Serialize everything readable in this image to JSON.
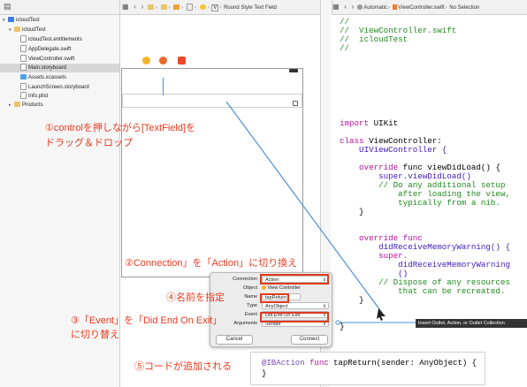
{
  "navigator": {
    "items": [
      {
        "label": "icloudTest",
        "icon": "project-icon",
        "arrow": "▾"
      },
      {
        "label": "icloudTest",
        "icon": "folder-icon",
        "arrow": "▾"
      },
      {
        "label": "icloudTest.entitlements",
        "icon": "file-icon"
      },
      {
        "label": "AppDelegate.swift",
        "icon": "swift-file-icon"
      },
      {
        "label": "ViewController.swift",
        "icon": "swift-file-icon"
      },
      {
        "label": "Main.storyboard",
        "icon": "storyboard-icon",
        "selected": true
      },
      {
        "label": "Assets.xcassets",
        "icon": "asset-catalog-icon"
      },
      {
        "label": "LaunchScreen.storyboard",
        "icon": "storyboard-icon"
      },
      {
        "label": "Info.plist",
        "icon": "plist-icon"
      },
      {
        "label": "Products",
        "icon": "folder-icon",
        "arrow": "▸"
      }
    ]
  },
  "canvas_bar": {
    "item": "V",
    "label": "Round Style Text Field"
  },
  "editor_bar": {
    "mode": "Automatic",
    "file": "ViewController.swift",
    "selection": "No Selection"
  },
  "code": [
    "//",
    "//  ViewController.swift",
    "//  icloudTest",
    "//",
    "import UIKit",
    "class ViewController:",
    "    UIViewController {",
    "    override func viewDidLoad() {",
    "        super.viewDidLoad()",
    "        // Do any additional setup",
    "            after loading the view,",
    "            typically from a nib.",
    "    }",
    "    override func",
    "        didReceiveMemoryWarning() {",
    "        super.",
    "            didReceiveMemoryWarning",
    "            ()",
    "        // Dispose of any resources",
    "            that can be recreated.",
    "    }",
    "}"
  ],
  "popover": {
    "connection_label": "Connection",
    "connection_value": "Action",
    "object_label": "Object",
    "object_value": "View Controller",
    "name_label": "Name",
    "name_value": "tapReturn",
    "type_label": "Type",
    "type_value": "AnyObject",
    "event_label": "Event",
    "event_value": "Did End On Exit",
    "arguments_label": "Arguments",
    "arguments_value": "Sender",
    "cancel": "Cancel",
    "connect": "Connect"
  },
  "tooltip": "Insert Outlet, Action, or Outlet Collection",
  "result_code": {
    "line1_attr": "@IBAction",
    "line1_kw": "func",
    "line1_rest": "tapReturn(sender: AnyObject) {",
    "line2": "}"
  },
  "annotations": {
    "step1_line1": "①controlを押しながら[TextField]を",
    "step1_line2": "ドラッグ＆ドロップ",
    "step2": "②Connection」を「Action」に切り換え",
    "step3_line1": "③「Event」を「Did End On Exit」",
    "step3_line2": "に切り替え",
    "step4": "④名前を指定",
    "step5": "⑤コードが追加される"
  },
  "colors": {
    "annotation": "#e8391d",
    "drag_line": "#4a90d9",
    "comment": "#1f8a1f",
    "keyword": "#b4139c"
  }
}
